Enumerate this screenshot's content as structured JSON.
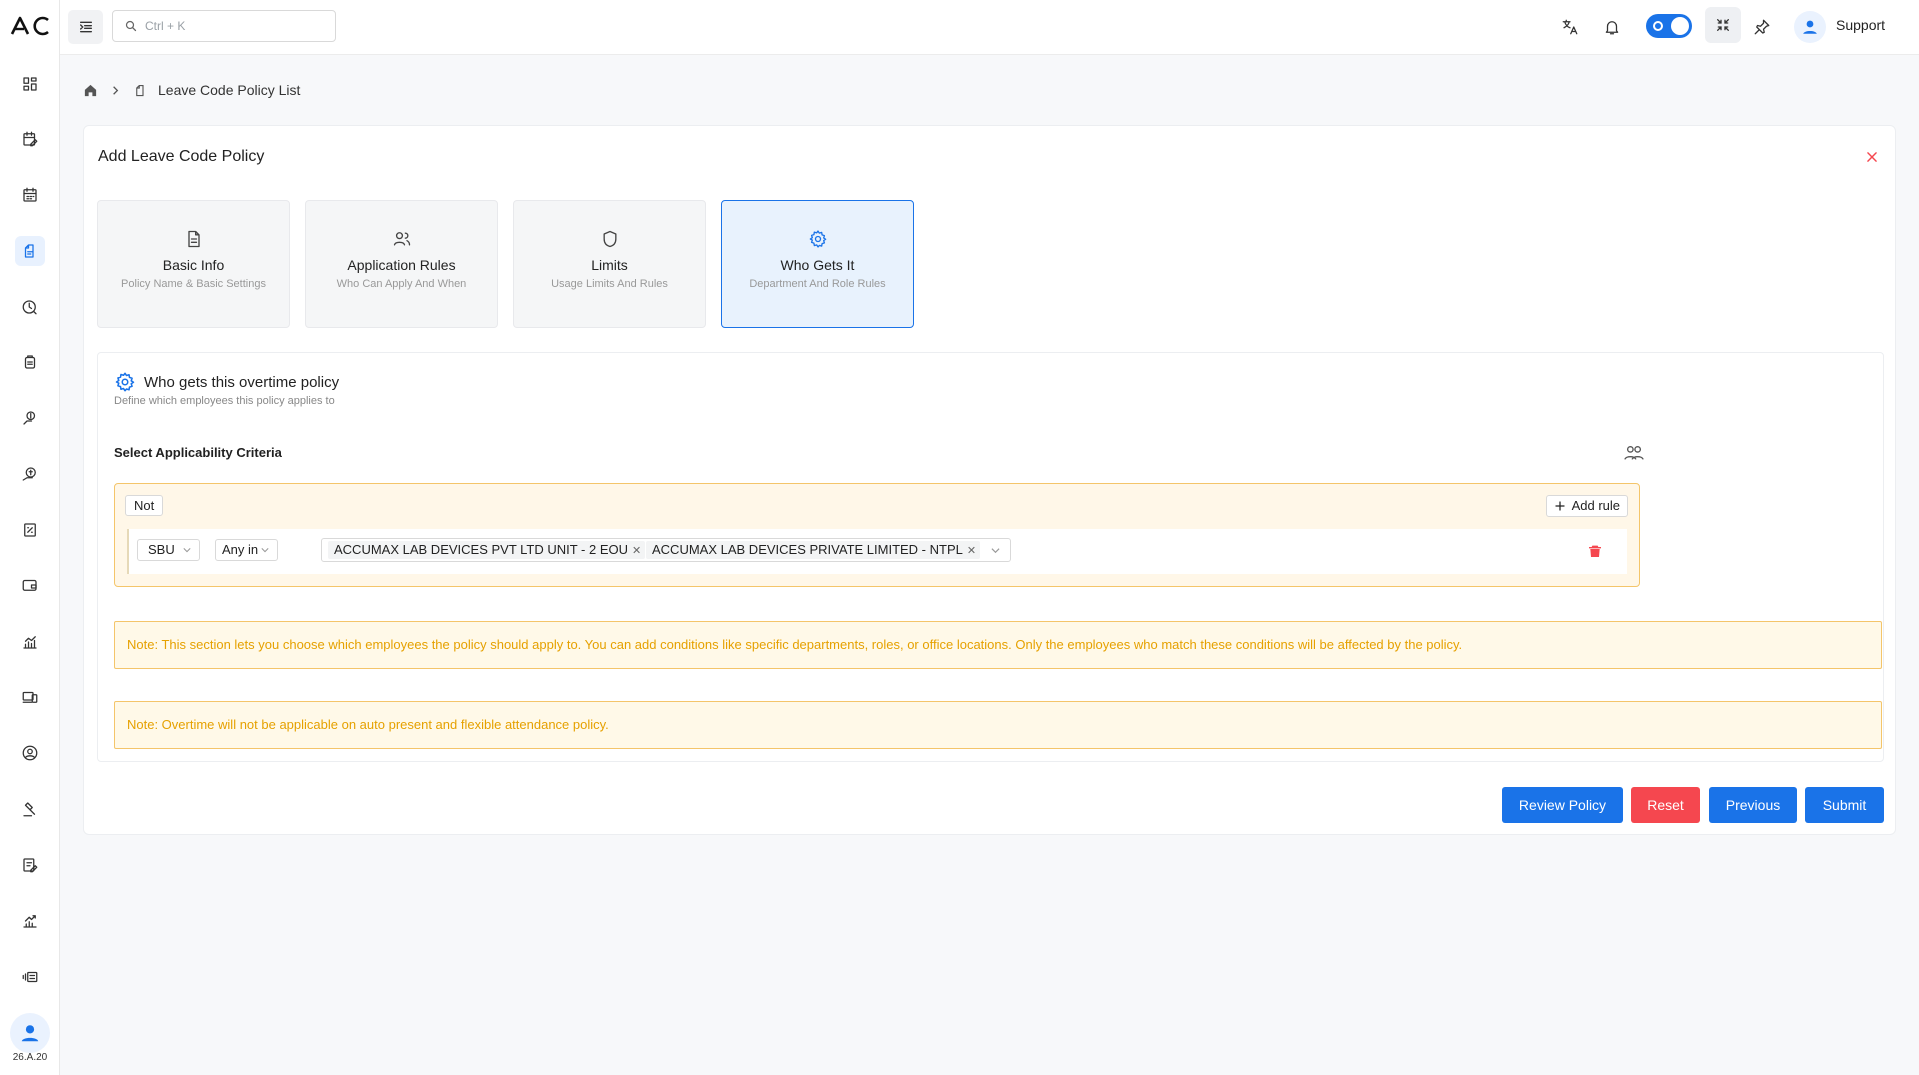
{
  "app": {
    "logo_text": "AC",
    "version": "26.A.20"
  },
  "topbar": {
    "search_placeholder": "Ctrl + K",
    "support_label": "Support"
  },
  "breadcrumb": {
    "current": "Leave Code Policy List"
  },
  "form": {
    "title": "Add Leave Code Policy",
    "steps": [
      {
        "title": "Basic Info",
        "subtitle": "Policy Name & Basic Settings",
        "icon": "document-icon"
      },
      {
        "title": "Application Rules",
        "subtitle": "Who Can Apply And When",
        "icon": "users-icon"
      },
      {
        "title": "Limits",
        "subtitle": "Usage Limits And Rules",
        "icon": "shield-icon"
      },
      {
        "title": "Who Gets It",
        "subtitle": "Department And Role Rules",
        "icon": "gear-icon",
        "active": true
      }
    ],
    "section": {
      "title": "Who gets this overtime policy",
      "subtitle": "Define which employees this policy applies to",
      "criteria_label": "Select Applicability Criteria"
    },
    "rule": {
      "not_label": "Not",
      "add_rule_label": "Add rule",
      "field": "SBU",
      "operator": "Any in",
      "values": [
        "ACCUMAX LAB DEVICES PVT LTD UNIT - 2 EOU",
        "ACCUMAX LAB DEVICES PRIVATE LIMITED - NTPL"
      ]
    },
    "notes": [
      "Note: This section lets you choose which employees the policy should apply to. You can add conditions like specific departments, roles, or office locations. Only the employees who match these conditions will be affected by the policy.",
      "Note: Overtime will not be applicable on auto present and flexible attendance policy."
    ],
    "buttons": {
      "review": "Review Policy",
      "reset": "Reset",
      "previous": "Previous",
      "submit": "Submit"
    }
  },
  "colors": {
    "primary": "#1a73e8",
    "danger": "#f5474f",
    "warning_border": "#f4c56a",
    "warning_text": "#e6a100"
  }
}
